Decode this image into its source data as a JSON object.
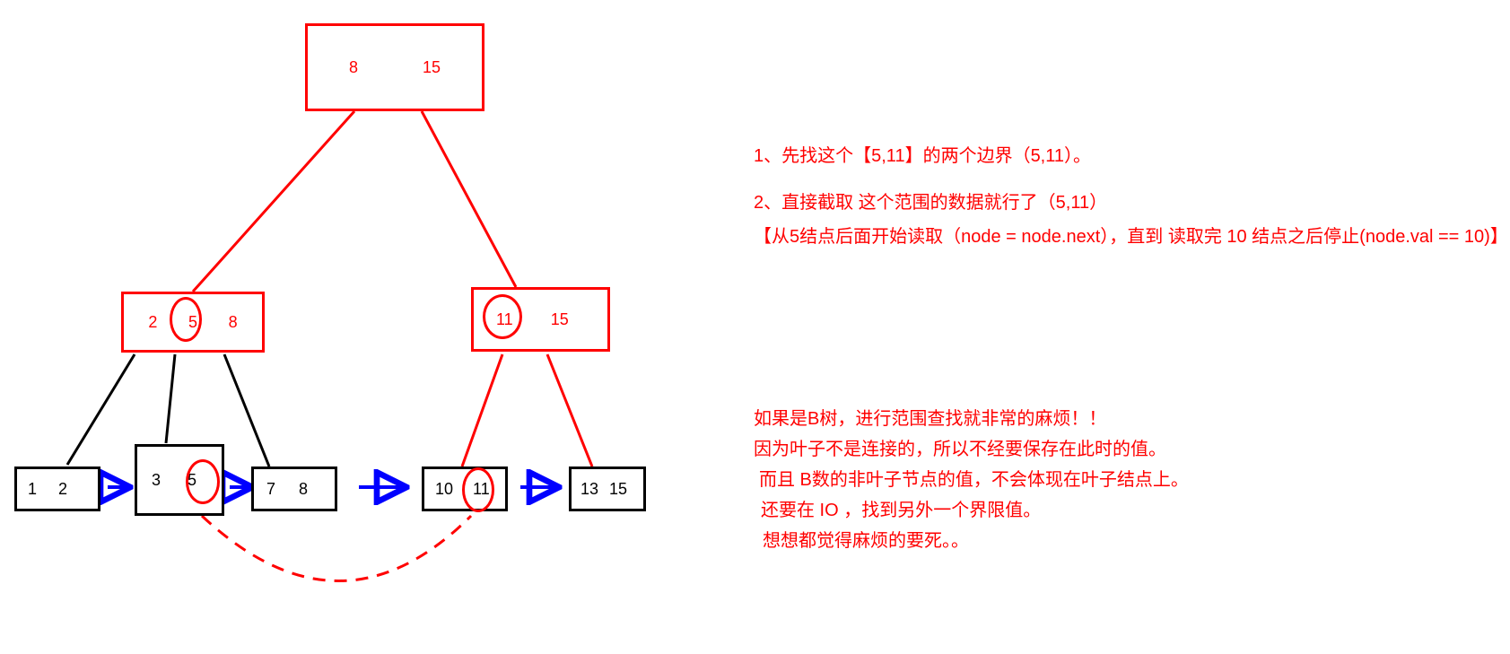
{
  "nodes": {
    "root": {
      "v1": "8",
      "v2": "15"
    },
    "mid_left": {
      "v1": "2",
      "v2": "5",
      "v3": "8"
    },
    "mid_right": {
      "v1": "11",
      "v2": "15"
    },
    "leaf1": {
      "v1": "1",
      "v2": "2"
    },
    "leaf2": {
      "v1": "3",
      "v2": "5"
    },
    "leaf3": {
      "v1": "7",
      "v2": "8"
    },
    "leaf4": {
      "v1": "10",
      "v2": "11"
    },
    "leaf5": {
      "v1": "13",
      "v2": "15"
    }
  },
  "text_upper": {
    "line1": "1、先找这个【5,11】的两个边界（5,11）。",
    "line2": "2、直接截取 这个范围的数据就行了（5,11）",
    "line3": "【从5结点后面开始读取（node = node.next），直到 读取完 10 结点之后停止(node.val == 10)】"
  },
  "text_lower": {
    "line1": "如果是B树，进行范围查找就非常的麻烦！！",
    "line2": "因为叶子不是连接的，所以不经要保存在此时的值。",
    "line3": "而且 B数的非叶子节点的值，不会体现在叶子结点上。",
    "line4": "还要在 IO ，找到另外一个界限值。",
    "line5": "想想都觉得麻烦的要死。。"
  }
}
